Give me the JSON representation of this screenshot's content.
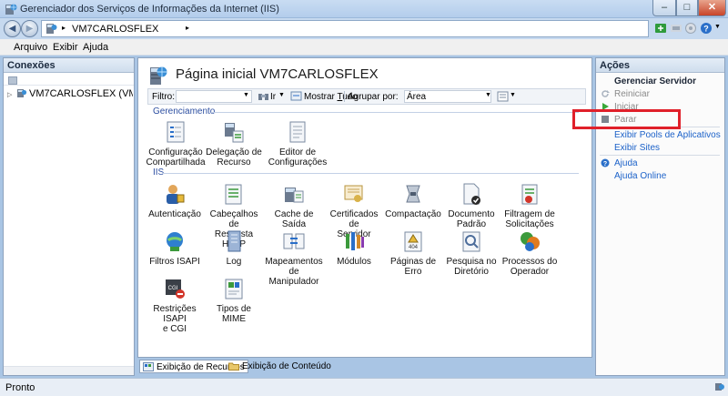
{
  "window": {
    "title": "Gerenciador dos Serviços de Informações da Internet (IIS)",
    "min_glyph": "–",
    "max_glyph": "□",
    "close_glyph": "✕"
  },
  "address": {
    "crumb": "VM7CARLOSFLEX",
    "arrow": "▸"
  },
  "menu": {
    "items": [
      "Arquivo",
      "Exibir",
      "Ajuda"
    ]
  },
  "connections": {
    "header": "Conexões",
    "tree_node": "VM7CARLOSFLEX (VM7CARLOSFLEX\\"
  },
  "home": {
    "title": "Página inicial VM7CARLOSFLEX",
    "filter_label": "Filtro:",
    "ir_label": "Ir",
    "show_all_prefix": "Mostrar ",
    "show_all_u": "T",
    "show_all_suffix": "udo",
    "group_by_label": "Agrupar por:",
    "group_by_value": "Área"
  },
  "groups": {
    "management": "Gerenciamento",
    "iis": "IIS"
  },
  "features": {
    "management": [
      [
        "Configuração",
        "Compartilhada"
      ],
      [
        "Delegação de",
        "Recurso"
      ],
      [
        "Editor de",
        "Configurações"
      ]
    ],
    "iis_row1": [
      [
        "Autenticação",
        ""
      ],
      [
        "Cabeçalhos de",
        "Resposta HTTP"
      ],
      [
        "Cache de Saída",
        ""
      ],
      [
        "Certificados de",
        "Servidor"
      ],
      [
        "Compactação",
        ""
      ],
      [
        "Documento",
        "Padrão"
      ],
      [
        "Filtragem de",
        "Solicitações"
      ]
    ],
    "iis_row2": [
      [
        "Filtros ISAPI",
        ""
      ],
      [
        "Log",
        ""
      ],
      [
        "Mapeamentos",
        "de Manipulador"
      ],
      [
        "Módulos",
        ""
      ],
      [
        "Páginas de Erro",
        ""
      ],
      [
        "Pesquisa no",
        "Diretório"
      ],
      [
        "Processos do",
        "Operador"
      ]
    ],
    "iis_row3": [
      [
        "Restrições ISAPI",
        "e CGI"
      ],
      [
        "Tipos de MIME",
        ""
      ]
    ]
  },
  "tabs": {
    "features_view": "Exibição de Recursos",
    "content_view": "Exibição de Conteúdo"
  },
  "actions": {
    "header": "Ações",
    "section_title": "Gerenciar Servidor",
    "restart": "Reiniciar",
    "start": "Iniciar",
    "stop": "Parar",
    "app_pools": "Exibir Pools de Aplicativos",
    "sites": "Exibir Sites",
    "help": "Ajuda",
    "online_help": "Ajuda Online"
  },
  "status": {
    "text": "Pronto"
  },
  "colors": {
    "link": "#1c62c9",
    "group_header": "#2d4fa1",
    "highlight_box": "#e0202a"
  }
}
